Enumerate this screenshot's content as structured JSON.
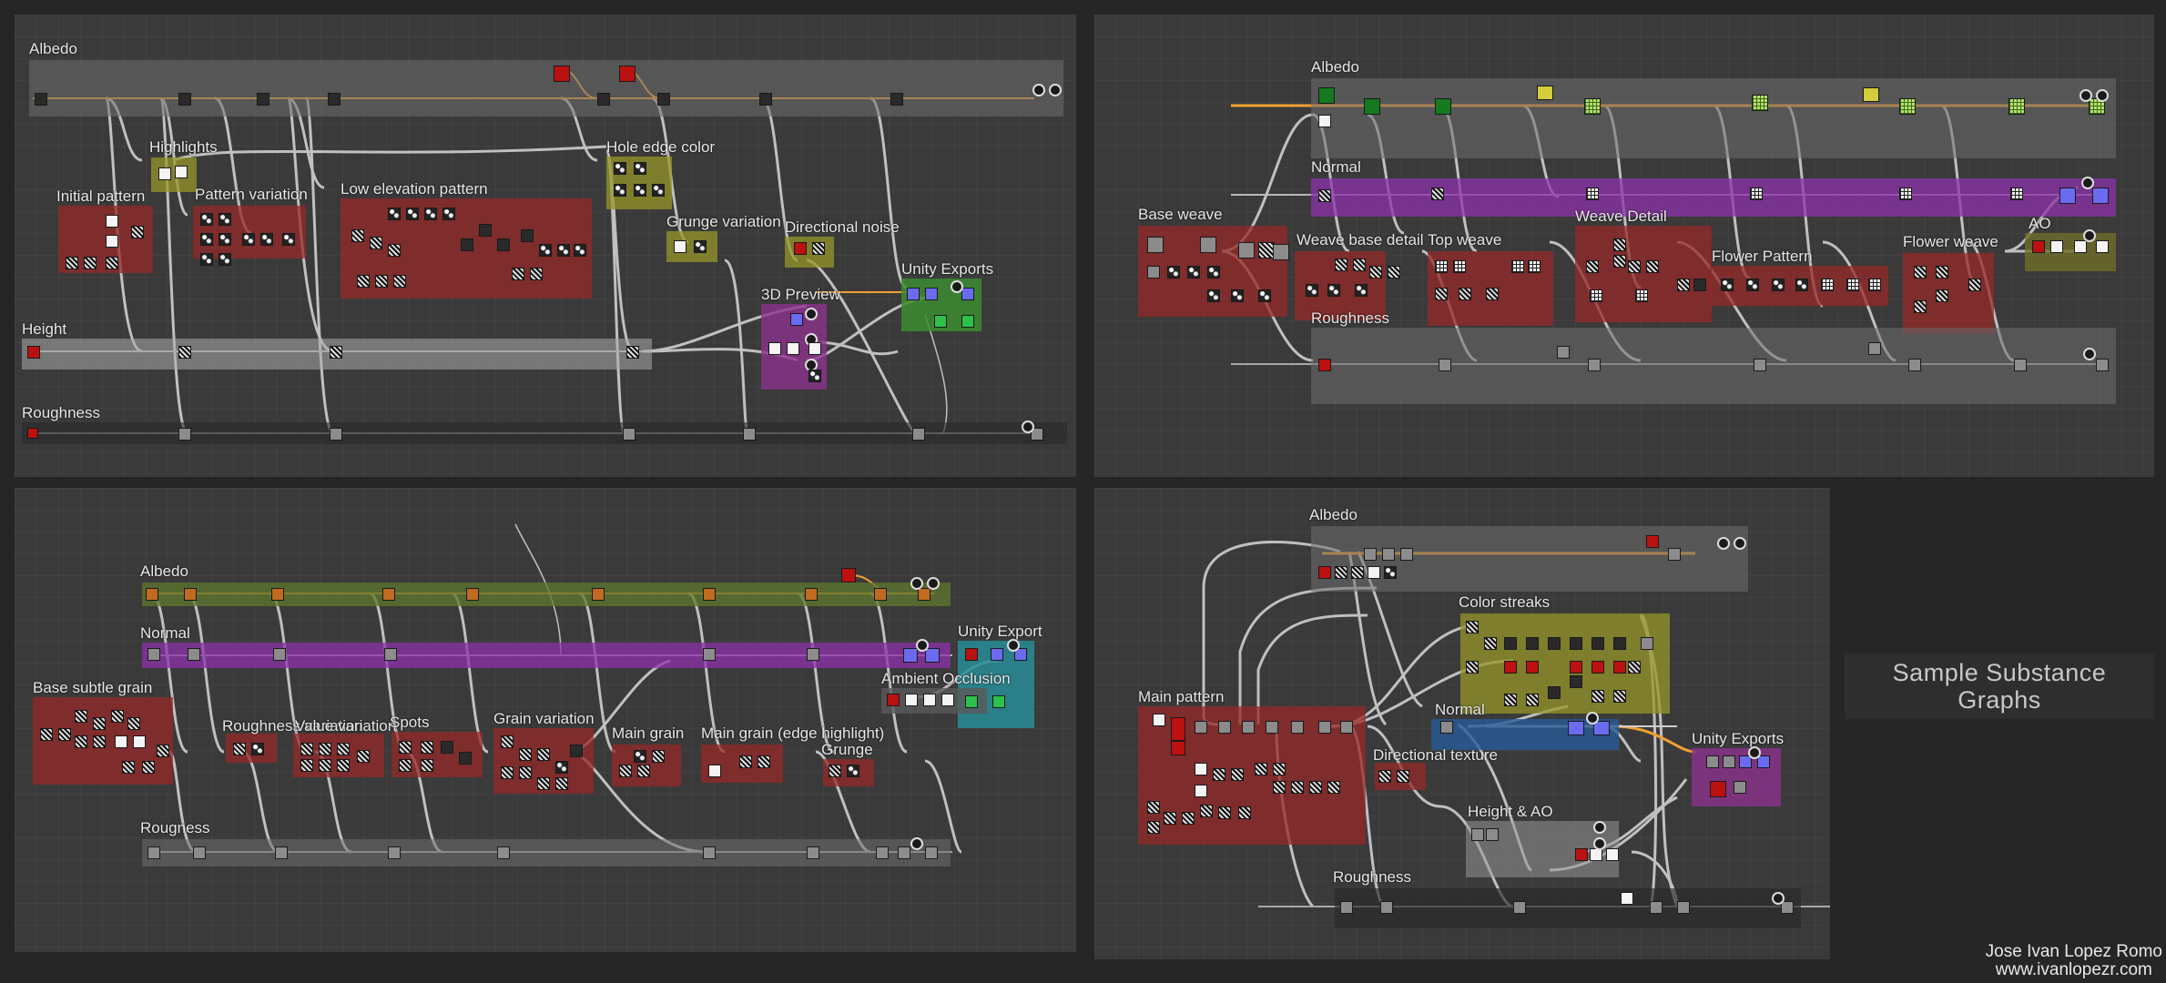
{
  "caption": {
    "line1": "Sample Substance",
    "line2": "Graphs"
  },
  "credit": {
    "name": "Jose Ivan Lopez Romo",
    "site": "www.ivanlopezr.com"
  },
  "colors": {
    "background": "#262626",
    "panel": "#3a3a3a",
    "frame_red": "#7a2a2a",
    "frame_olive": "#6b6b1e",
    "frame_purple": "#6a2a78",
    "frame_green": "#2f6a2a",
    "frame_teal": "#1f7a80",
    "frame_blue": "#2a4a78",
    "link_orange": "#f0a030",
    "link_gray": "#d8d8d8"
  },
  "graphs": [
    {
      "id": "graph-1",
      "frames": [
        {
          "key": "albedo",
          "label": "Albedo"
        },
        {
          "key": "highlights",
          "label": "Highlights"
        },
        {
          "key": "initial-pattern",
          "label": "Initial pattern"
        },
        {
          "key": "pattern-variation",
          "label": "Pattern variation"
        },
        {
          "key": "low-elevation-pattern",
          "label": "Low elevation pattern"
        },
        {
          "key": "hole-edge-color",
          "label": "Hole edge color"
        },
        {
          "key": "grunge-variation",
          "label": "Grunge variation"
        },
        {
          "key": "directional-noise",
          "label": "Directional noise"
        },
        {
          "key": "unity-exports",
          "label": "Unity Exports"
        },
        {
          "key": "3d-preview",
          "label": "3D Preview"
        },
        {
          "key": "height",
          "label": "Height"
        },
        {
          "key": "roughness",
          "label": "Roughness"
        }
      ]
    },
    {
      "id": "graph-2",
      "frames": [
        {
          "key": "albedo",
          "label": "Albedo"
        },
        {
          "key": "normal",
          "label": "Normal"
        },
        {
          "key": "base-weave",
          "label": "Base weave"
        },
        {
          "key": "weave-base-detail",
          "label": "Weave base detail"
        },
        {
          "key": "top-weave",
          "label": "Top weave"
        },
        {
          "key": "weave-detail",
          "label": "Weave Detail"
        },
        {
          "key": "flower-pattern",
          "label": "Flower Pattern"
        },
        {
          "key": "flower-weave",
          "label": "Flower weave"
        },
        {
          "key": "ao",
          "label": "AO"
        },
        {
          "key": "roughness",
          "label": "Roughness"
        }
      ]
    },
    {
      "id": "graph-3",
      "frames": [
        {
          "key": "albedo",
          "label": "Albedo"
        },
        {
          "key": "normal",
          "label": "Normal"
        },
        {
          "key": "base-subtle-grain",
          "label": "Base subtle grain"
        },
        {
          "key": "roughness-variation",
          "label": "Roughness variation"
        },
        {
          "key": "value-variation",
          "label": "Value variation"
        },
        {
          "key": "spots",
          "label": "Spots"
        },
        {
          "key": "grain-variation",
          "label": "Grain variation"
        },
        {
          "key": "main-grain",
          "label": "Main grain"
        },
        {
          "key": "main-grain-edge",
          "label": "Main grain (edge highlight)"
        },
        {
          "key": "grunge",
          "label": "Grunge"
        },
        {
          "key": "unity-export",
          "label": "Unity Export"
        },
        {
          "key": "ambient-occlusion",
          "label": "Ambient Occlusion"
        },
        {
          "key": "rougness",
          "label": "Rougness"
        }
      ]
    },
    {
      "id": "graph-4",
      "frames": [
        {
          "key": "albedo",
          "label": "Albedo"
        },
        {
          "key": "color-streaks",
          "label": "Color streaks"
        },
        {
          "key": "main-pattern",
          "label": "Main pattern"
        },
        {
          "key": "normal",
          "label": "Normal"
        },
        {
          "key": "directional-texture",
          "label": "Directional texture"
        },
        {
          "key": "height-ao",
          "label": "Height & AO"
        },
        {
          "key": "unity-exports",
          "label": "Unity Exports"
        },
        {
          "key": "roughness",
          "label": "Roughness"
        }
      ]
    }
  ]
}
